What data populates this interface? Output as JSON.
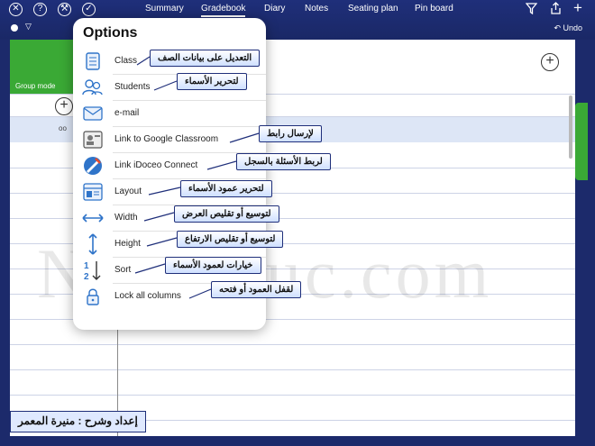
{
  "topbar": {
    "tabs": [
      {
        "label": "Summary",
        "active": false
      },
      {
        "label": "Gradebook",
        "active": true
      },
      {
        "label": "Diary",
        "active": false
      },
      {
        "label": "Notes",
        "active": false
      },
      {
        "label": "Seating plan",
        "active": false
      },
      {
        "label": "Pin board",
        "active": false
      }
    ],
    "undo_label": "Undo",
    "left_icons": [
      "close-circle-icon",
      "help-circle-icon",
      "tools-icon",
      "check-circle-icon"
    ],
    "right_icons": [
      "filter-icon",
      "share-icon",
      "add-icon"
    ]
  },
  "sheet": {
    "group_mode_label": "Group mode",
    "row_marker": "oo",
    "watermark_text": "NewEduc.com"
  },
  "options": {
    "title": "Options",
    "items": [
      {
        "label": "Class",
        "icon": "notebook-icon"
      },
      {
        "label": "Students",
        "icon": "students-icon"
      },
      {
        "label": "e-mail",
        "icon": "email-icon"
      },
      {
        "label": "Link to Google Classroom",
        "icon": "google-classroom-icon"
      },
      {
        "label": "Link iDoceo Connect",
        "icon": "idoceo-connect-icon"
      },
      {
        "label": "Layout",
        "icon": "layout-icon"
      },
      {
        "label": "Width",
        "icon": "width-arrows-icon"
      },
      {
        "label": "Height",
        "icon": "height-arrows-icon"
      },
      {
        "label": "Sort",
        "icon": "sort-icon"
      },
      {
        "label": "Lock all columns",
        "icon": "lock-icon"
      }
    ]
  },
  "callouts": {
    "class": "التعديل على بيانات الصف",
    "students": "لتحرير الأسماء",
    "google": "لإرسال رابط",
    "idoceo": "لربط الأسئلة بالسجل",
    "layout": "لتحرير عمود الأسماء",
    "width": "لتوسيع أو تقليص العرض",
    "height": "لتوسيع أو تقليص الارتفاع",
    "sort": "خيارات لعمود الأسماء",
    "lock": "لقفل العمود أو فتحه"
  },
  "credit": "إعداد وشرح : منيرة المعمر",
  "colors": {
    "navy": "#1c2a6b",
    "green": "#3aa935",
    "selected_row": "#dde6f6",
    "icon_blue": "#2f74c9"
  }
}
